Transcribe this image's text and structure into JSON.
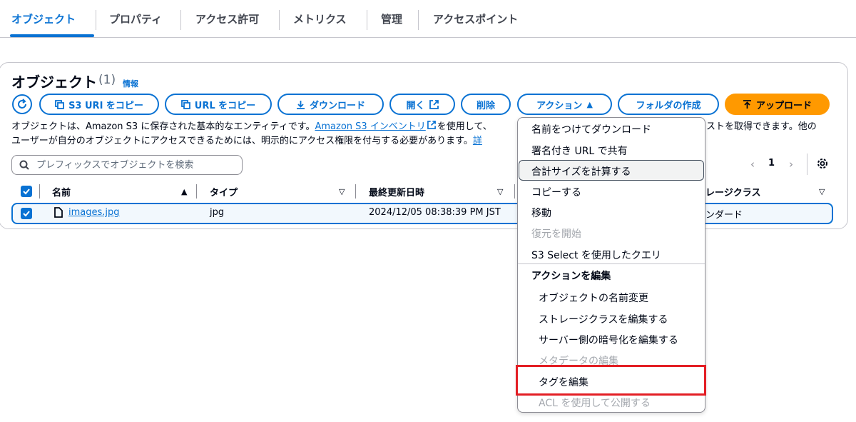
{
  "tabs": [
    {
      "label": "オブジェクト",
      "active": true
    },
    {
      "label": "プロパティ"
    },
    {
      "label": "アクセス許可"
    },
    {
      "label": "メトリクス"
    },
    {
      "label": "管理"
    },
    {
      "label": "アクセスポイント"
    }
  ],
  "header": {
    "title": "オブジェクト",
    "count": "(1)",
    "info": "情報"
  },
  "toolbar": {
    "copy_s3_uri": "S3 URI をコピー",
    "copy_url": "URL をコピー",
    "download": "ダウンロード",
    "open": "開く",
    "delete": "削除",
    "actions": "アクション",
    "create_folder": "フォルダの作成",
    "upload": "アップロード"
  },
  "description": {
    "line1_pre": "オブジェクトは、Amazon S3 に保存された基本的なエンティティです。",
    "line1_link": "Amazon S3 インベントリ",
    "line1_post": "を使用して、",
    "line1_end": "ストを取得できます。他の",
    "line2": "ユーザーが自分のオブジェクトにアクセスできるためには、明示的にアクセス権限を付与する必要があります。",
    "line2_link": "詳"
  },
  "search": {
    "placeholder": "プレフィックスでオブジェクトを検索"
  },
  "pagination": {
    "page": "1"
  },
  "table": {
    "columns": [
      "名前",
      "タイプ",
      "最終更新日時",
      "レージクラス"
    ],
    "rows": [
      {
        "name": "images.jpg",
        "type": "jpg",
        "modified": "2024/12/05 08:38:39 PM JST",
        "storage": "ンダード"
      }
    ]
  },
  "menu": {
    "items": [
      {
        "label": "名前をつけてダウンロード"
      },
      {
        "label": "署名付き URL で共有"
      },
      {
        "label": "合計サイズを計算する"
      },
      {
        "label": "コピーする"
      },
      {
        "label": "移動"
      },
      {
        "label": "復元を開始",
        "disabled": true
      },
      {
        "label": "S3 Select を使用したクエリ"
      }
    ],
    "group_label": "アクションを編集",
    "sub_items": [
      {
        "label": "オブジェクトの名前変更"
      },
      {
        "label": "ストレージクラスを編集する"
      },
      {
        "label": "サーバー側の暗号化を編集する"
      },
      {
        "label": "メタデータの編集",
        "disabled": true
      },
      {
        "label": "タグを編集"
      },
      {
        "label": "ACL を使用して公開する",
        "disabled": true
      }
    ]
  },
  "colors": {
    "accent": "#0972d3",
    "primary_button": "#ff9900",
    "highlight_box": "#e31e24"
  }
}
